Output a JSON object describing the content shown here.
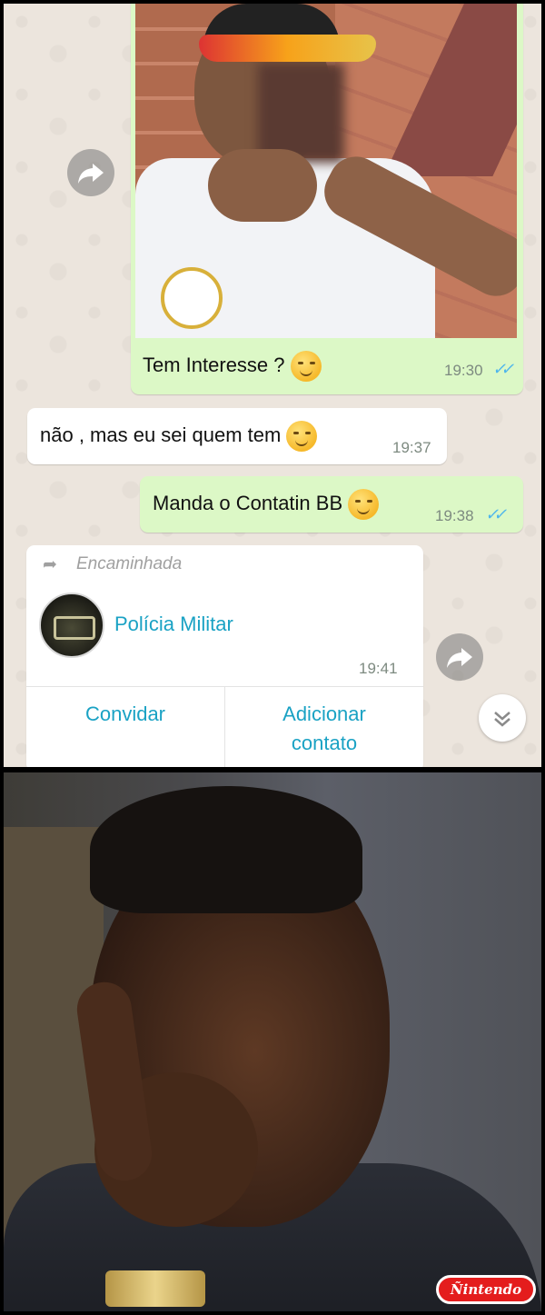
{
  "messages": [
    {
      "direction": "outgoing",
      "text": "Tem Interesse ?",
      "time": "19:30",
      "ticks": "✓✓",
      "has_image": true
    },
    {
      "direction": "incoming",
      "text": "não , mas eu sei quem tem",
      "time": "19:37"
    },
    {
      "direction": "outgoing",
      "text": "Manda o Contatin BB",
      "time": "19:38",
      "ticks": "✓✓"
    }
  ],
  "contact_card": {
    "forwarded_label": "Encaminhada",
    "name": "Polícia Militar",
    "time": "19:41",
    "actions": {
      "invite": "Convidar",
      "add_line1": "Adicionar",
      "add_line2": "contato"
    }
  },
  "icons": {
    "forward": "forward-arrow-icon",
    "scroll_down": "double-chevron-down-icon",
    "read_receipt": "double-check-icon"
  },
  "colors": {
    "outgoing_bubble": "#dcf8c6",
    "incoming_bubble": "#ffffff",
    "chat_background": "#ece5dd",
    "link_blue": "#1aa2c4",
    "read_tick": "#4fb6ec",
    "watermark_red": "#e41d1d"
  },
  "watermark": "Ñintendo"
}
